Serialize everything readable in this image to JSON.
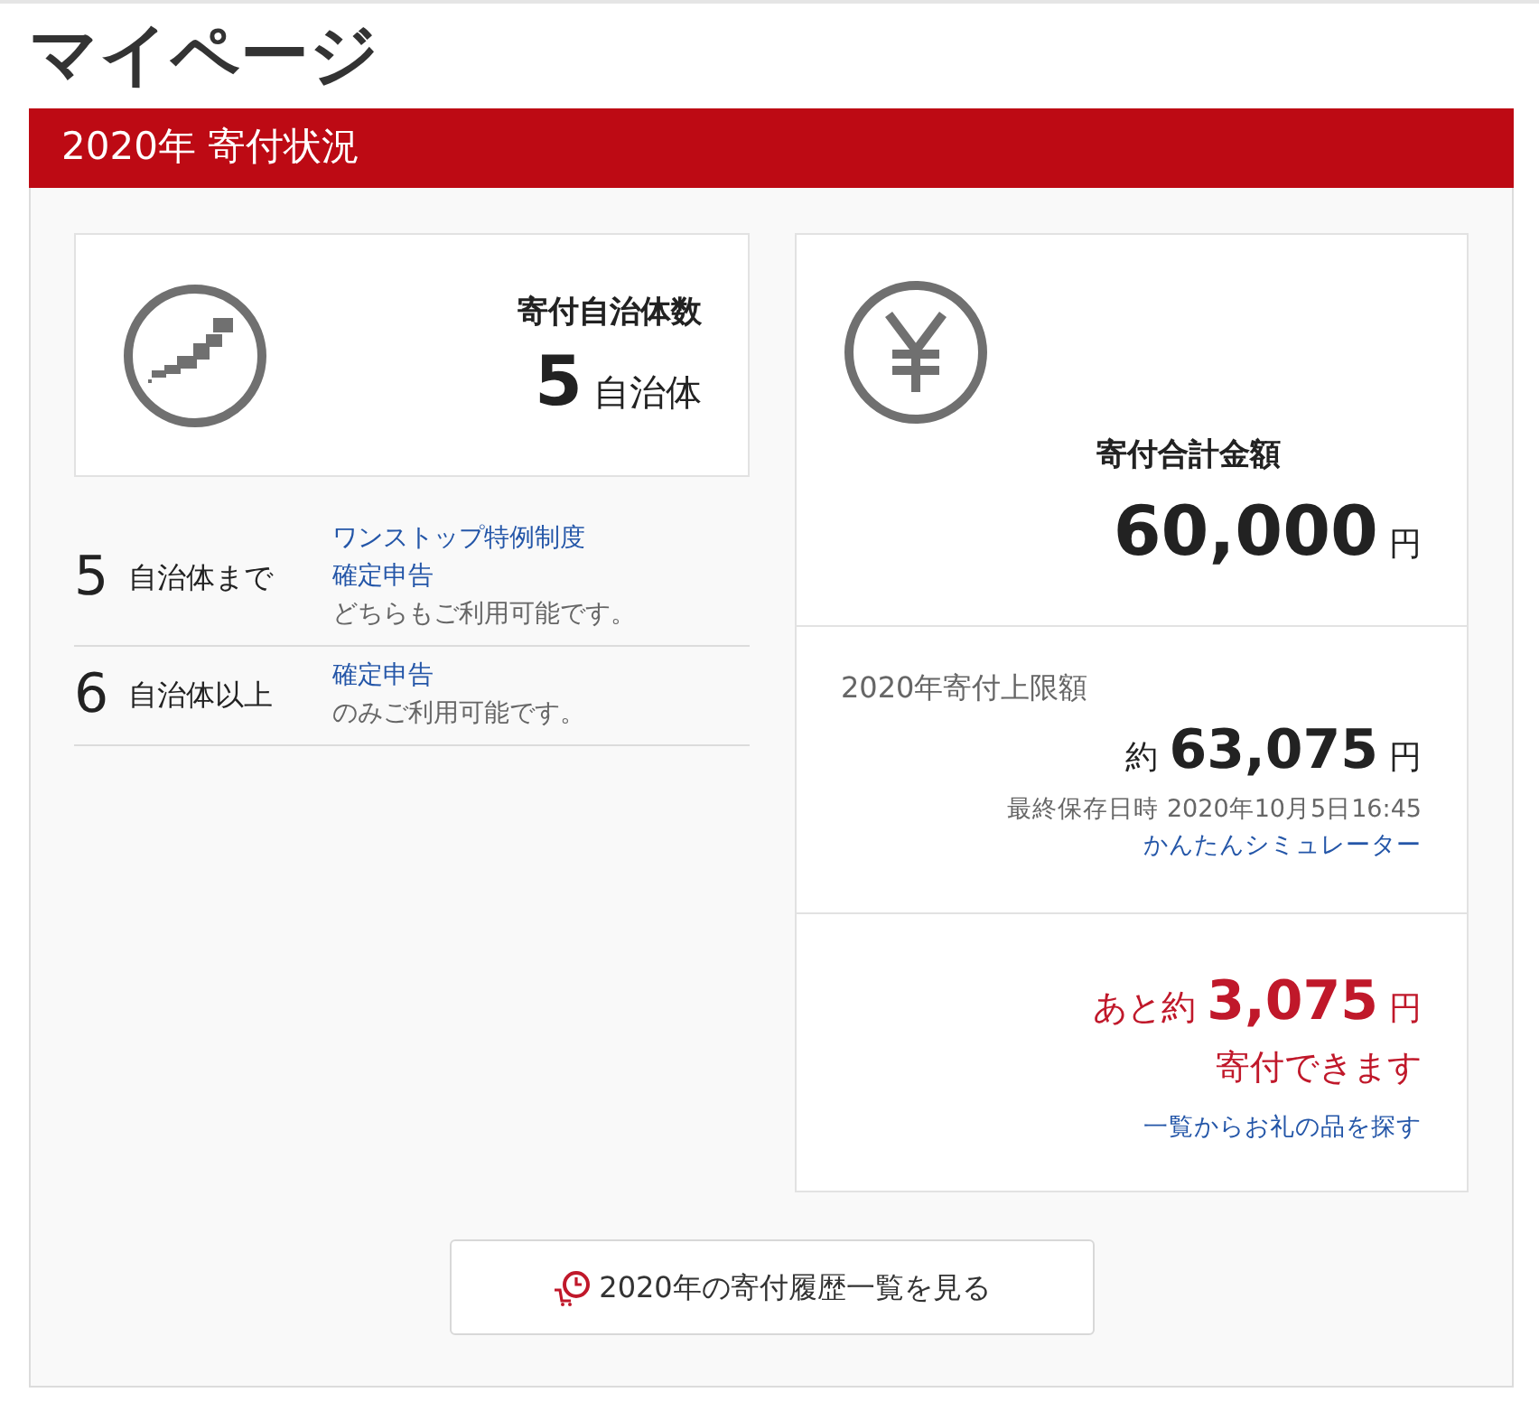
{
  "page_title": "マイページ",
  "section": {
    "title": "2020年 寄付状況"
  },
  "municipalities": {
    "label": "寄付自治体数",
    "count": "5",
    "unit": "自治体"
  },
  "rules": [
    {
      "number": "5",
      "label": "自治体まで",
      "lines": [
        {
          "kind": "link",
          "text": "ワンストップ特例制度"
        },
        {
          "kind": "link",
          "text": "確定申告"
        },
        {
          "kind": "text",
          "text": "どちらもご利用可能です。"
        }
      ]
    },
    {
      "number": "6",
      "label": "自治体以上",
      "lines": [
        {
          "kind": "link",
          "text": "確定申告"
        },
        {
          "kind": "text",
          "text": "のみご利用可能です。"
        }
      ]
    }
  ],
  "total": {
    "label": "寄付合計金額",
    "amount": "60,000",
    "unit": "円"
  },
  "limit": {
    "label": "2020年寄付上限額",
    "prefix": "約",
    "amount": "63,075",
    "unit": "円",
    "saved": "最終保存日時 2020年10月5日16:45",
    "simulator_link": "かんたんシミュレーター"
  },
  "remaining": {
    "prefix": "あと約",
    "amount": "3,075",
    "unit": "円",
    "caption": "寄付できます",
    "search_link": "一覧からお礼の品を探す"
  },
  "history_button": "2020年の寄付履歴一覧を見る"
}
